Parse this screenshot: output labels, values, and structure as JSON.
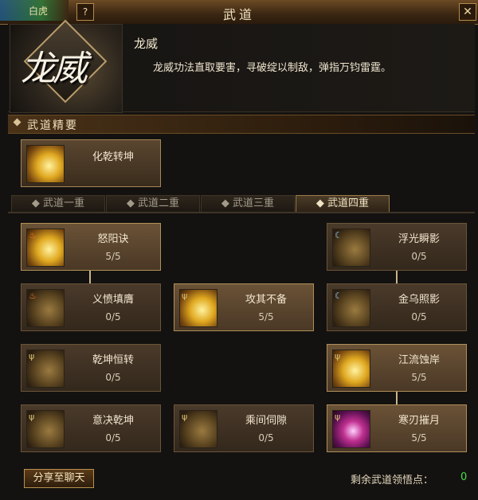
{
  "window": {
    "title": "武道",
    "help_label": "?",
    "close_label": "✕",
    "bg_tab_label": "白虎"
  },
  "header": {
    "emblem_text": "龙威",
    "skill_name": "龙威",
    "skill_desc": "龙威功法直取要害，寻破绽以制敌，弹指万钧雷霆。"
  },
  "section": {
    "title": "武道精要"
  },
  "essence": {
    "name": "化乾转坤"
  },
  "tabs": [
    {
      "label": "◆ 武道一重"
    },
    {
      "label": "◆ 武道二重"
    },
    {
      "label": "◆ 武道三重"
    },
    {
      "label": "◆ 武道四重"
    }
  ],
  "active_tab": 3,
  "skills": [
    {
      "name": "怒阳诀",
      "level": "5/5",
      "icon": "fire-palm-icon"
    },
    {
      "name": "浮光瞬影",
      "level": "0/5",
      "icon": "moon-palm-icon"
    },
    {
      "name": "义愤填膺",
      "level": "0/5",
      "icon": "fist-icon"
    },
    {
      "name": "攻其不备",
      "level": "5/5",
      "icon": "fist-icon"
    },
    {
      "name": "金乌照影",
      "level": "0/5",
      "icon": "moon-palm-icon"
    },
    {
      "name": "乾坤恒转",
      "level": "0/5",
      "icon": "palm-icon"
    },
    {
      "name": "江流蚀岸",
      "level": "5/5",
      "icon": "palm-icon"
    },
    {
      "name": "意决乾坤",
      "level": "0/5",
      "icon": "palm-icon"
    },
    {
      "name": "乘间伺隙",
      "level": "0/5",
      "icon": "fist-icon"
    },
    {
      "name": "寒刃摧月",
      "level": "5/5",
      "icon": "crimson-blade-icon"
    }
  ],
  "footer": {
    "share_label": "分享至聊天",
    "points_label": "剩余武道领悟点：",
    "points_value": "0"
  }
}
